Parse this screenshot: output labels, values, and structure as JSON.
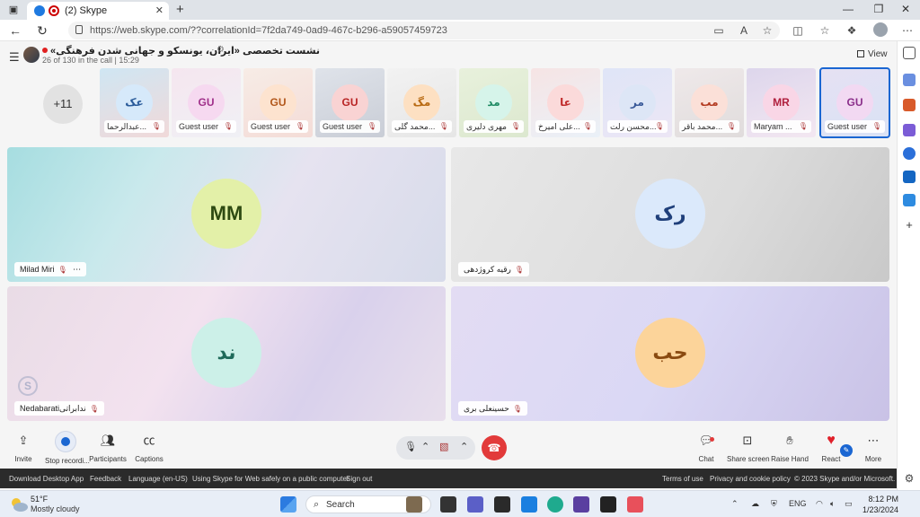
{
  "browser": {
    "tab_title": "(2) Skype",
    "url": "https://web.skype.com/??correlationId=7f2da749-0ad9-467c-b296-a59057459723"
  },
  "call": {
    "title": "نشست تخصصی «ایران، یونسکو و جهانی شدن فرهنگی»",
    "subtitle": "26 of 130 in the call | 15:29",
    "view_label": "View",
    "more_count": "+11"
  },
  "strip": [
    {
      "initials": "عک",
      "name": "عبدالرحما...",
      "bg": "linear-gradient(160deg,#cfe6f3,#f1d9d9)",
      "avbg": "#d6e9fa",
      "avcolor": "#2a5b9a"
    },
    {
      "initials": "GU",
      "name": "Guest user",
      "bg": "linear-gradient(160deg,#f5e6ef,#f0f0f5)",
      "avbg": "#f6d9f0",
      "avcolor": "#a0308a"
    },
    {
      "initials": "GU",
      "name": "Guest user",
      "bg": "linear-gradient(160deg,#f7ece6,#f4dcd7)",
      "avbg": "#fde3cf",
      "avcolor": "#b2571b"
    },
    {
      "initials": "GU",
      "name": "Guest user",
      "bg": "linear-gradient(160deg,#dfe3ea,#c9cdd6)",
      "avbg": "#f9d3d3",
      "avcolor": "#b82424"
    },
    {
      "initials": "مگ",
      "name": "محمد گلی...",
      "bg": "linear-gradient(160deg,#f2f2f2,#e6e6e6)",
      "avbg": "#fde0c2",
      "avcolor": "#b86a12"
    },
    {
      "initials": "مد",
      "name": "مهری دلیری",
      "bg": "linear-gradient(160deg,#e8f1dc,#dce8cf)",
      "avbg": "#d6f4ea",
      "avcolor": "#1f8a63"
    },
    {
      "initials": "عا",
      "name": "علی امیرخ...",
      "bg": "linear-gradient(160deg,#f6e4e4,#eaf1f8)",
      "avbg": "#fbdada",
      "avcolor": "#c02b2b"
    },
    {
      "initials": "مر",
      "name": "محسن رلت...",
      "bg": "linear-gradient(160deg,#dfe5f7,#ece6f5)",
      "avbg": "#dde6f6",
      "avcolor": "#3a5a99"
    },
    {
      "initials": "مب",
      "name": "محمد باقر...",
      "bg": "linear-gradient(160deg,#efe9ea,#e0dcdc)",
      "avbg": "#fbe0d8",
      "avcolor": "#b33a20"
    },
    {
      "initials": "MR",
      "name": "Maryam ...",
      "bg": "linear-gradient(160deg,#ddd6ec,#f3e7f1)",
      "avbg": "#f9d6e6",
      "avcolor": "#b0203e"
    },
    {
      "initials": "GU",
      "name": "Guest user",
      "bg": "linear-gradient(160deg,#e6e1f3,#d9e2f5)",
      "avbg": "#f2d9f2",
      "avcolor": "#8a2f8a"
    }
  ],
  "tiles": [
    {
      "initials": "MM",
      "name": "Milad Miri",
      "bg": "linear-gradient(120deg,#a6dde0 0%,#c9e9ec 30%,#e6e3f0 60%,#d7dbea 100%)",
      "avbg": "#e3f0a8",
      "avcolor": "#2e4a12"
    },
    {
      "initials": "رک",
      "name": "رقیه کروژدهی",
      "bg": "linear-gradient(120deg,#e8e8e8 0%,#dcdcdc 60%,#c9c9c9 100%)",
      "avbg": "#dbe9fb",
      "avcolor": "#1f3f7a"
    },
    {
      "initials": "ند",
      "name": "Nedabaratiندابراتی",
      "bg": "linear-gradient(120deg,#e9dce6 0%,#f3e2ef 40%,#d9d1ec 70%,#e8dfec 100%)",
      "avbg": "#ccf0e8",
      "avcolor": "#1f6a5a"
    },
    {
      "initials": "حب",
      "name": "حسینعلی بری",
      "bg": "linear-gradient(120deg,#e3dcf3 0%,#dad8f5 50%,#c9c2e6 100%)",
      "avbg": "#fcd49a",
      "avcolor": "#8a4a10"
    }
  ],
  "controls": {
    "invite": "Invite",
    "stop_recording": "Stop recordi...",
    "participants": "Participants",
    "captions": "Captions",
    "chat": "Chat",
    "share_screen": "Share screen",
    "raise_hand": "Raise Hand",
    "react": "React",
    "more": "More"
  },
  "footer": {
    "download": "Download Desktop App",
    "feedback": "Feedback",
    "language": "Language (en-US)",
    "using": "Using Skype for Web safely on a public computer",
    "signout": "Sign out",
    "terms": "Terms of use",
    "privacy": "Privacy and cookie policy",
    "copyright": "© 2023 Skype and/or Microsoft."
  },
  "taskbar": {
    "temp": "51°F",
    "weather": "Mostly cloudy",
    "search": "Search",
    "lang": "ENG",
    "time": "8:12 PM",
    "date": "1/23/2024"
  },
  "colors": {
    "accent": "#1a66d2",
    "hangup": "#e23a3a",
    "footer_bg": "#2b2b2b"
  }
}
